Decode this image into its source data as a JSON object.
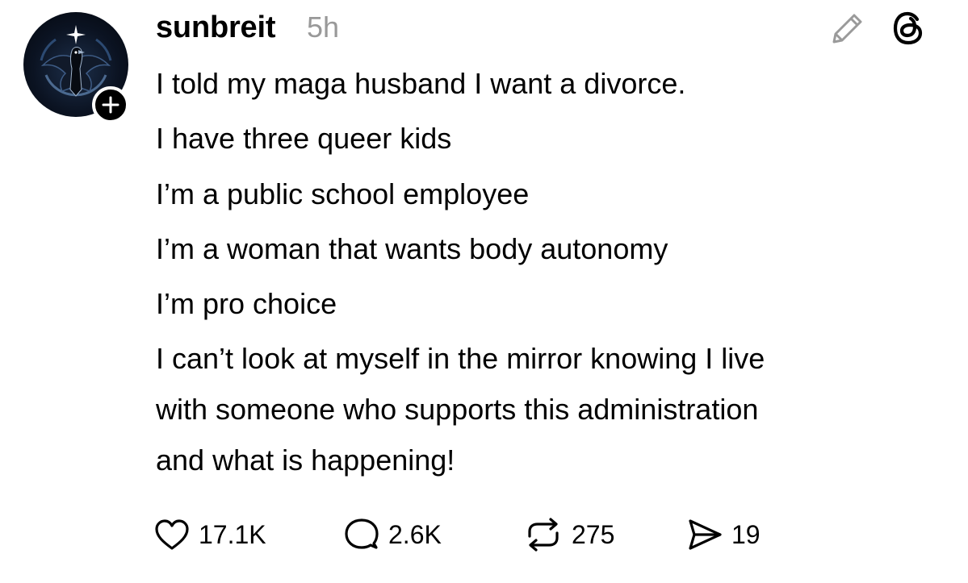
{
  "post": {
    "username": "sunbreit",
    "timestamp": "5h",
    "lines": [
      "I told my maga husband I want a divorce.",
      "I have three queer kids",
      "I’m a public school employee",
      "I’m a woman that wants body autonomy",
      "I’m pro choice",
      "I can’t look at myself in the mirror knowing I live",
      "with someone who supports this administration",
      "and what is happening!"
    ]
  },
  "actions": {
    "likes": "17.1K",
    "replies": "2.6K",
    "reposts": "275",
    "shares": "19"
  },
  "icons": {
    "avatar": "raven-emblem-avatar",
    "follow": "plus-icon",
    "edit": "pencil-icon",
    "app": "threads-logo-icon",
    "like": "heart-icon",
    "reply": "speech-bubble-icon",
    "repost": "repost-icon",
    "share": "paper-plane-icon"
  }
}
